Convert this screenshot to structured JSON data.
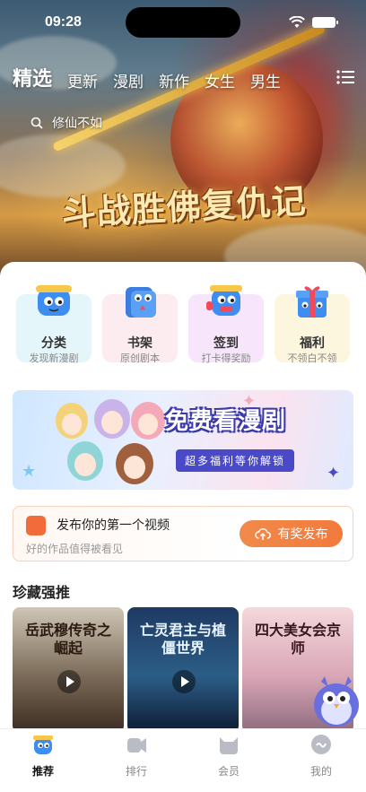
{
  "status_bar": {
    "time": "09:28"
  },
  "top_tabs": [
    {
      "label": "精选",
      "active": true
    },
    {
      "label": "更新",
      "active": false
    },
    {
      "label": "漫剧",
      "active": false
    },
    {
      "label": "新作",
      "active": false
    },
    {
      "label": "女生",
      "active": false
    },
    {
      "label": "男生",
      "active": false
    }
  ],
  "search": {
    "placeholder_text": "修仙不如"
  },
  "hero_banner": {
    "title": "斗战胜佛复仇记"
  },
  "categories": [
    {
      "title": "分类",
      "subtitle": "发现新漫剧",
      "bg": "#e5f6fb",
      "icon": "category-mascot-icon"
    },
    {
      "title": "书架",
      "subtitle": "原创剧本",
      "bg": "#fdecef",
      "icon": "bookshelf-mascot-icon"
    },
    {
      "title": "签到",
      "subtitle": "打卡得奖励",
      "bg": "#f7e6fb",
      "icon": "checkin-mascot-icon"
    },
    {
      "title": "福利",
      "subtitle": "不领白不领",
      "bg": "#fdf6df",
      "icon": "gift-mascot-icon"
    }
  ],
  "promo_banner": {
    "headline": "免费看漫剧",
    "subline": "超多福利等你解锁"
  },
  "upload_card": {
    "title": "发布你的第一个视频",
    "description": "好的作品值得被看见",
    "button_label": "有奖发布"
  },
  "section": {
    "title": "珍藏强推"
  },
  "posters": [
    {
      "title": "岳武穆传奇之崛起",
      "colors": [
        "#cfc6b6",
        "#7b6a58",
        "#3b2c22"
      ],
      "text_color": "#2a1a10"
    },
    {
      "title": "亡灵君主与植僵世界",
      "colors": [
        "#1f3a63",
        "#2b5d86",
        "#0e1b33"
      ],
      "text_color": "#e8f4ff"
    },
    {
      "title": "四大美女会京师",
      "colors": [
        "#f4d8dc",
        "#d9a6b6",
        "#8d6b7d"
      ],
      "text_color": "#3a1820"
    }
  ],
  "bottom_nav": [
    {
      "label": "推荐",
      "active": true,
      "icon": "recommend-icon"
    },
    {
      "label": "排行",
      "active": false,
      "icon": "ranking-icon"
    },
    {
      "label": "会员",
      "active": false,
      "icon": "membership-icon"
    },
    {
      "label": "我的",
      "active": false,
      "icon": "profile-icon"
    }
  ],
  "colors": {
    "accent": "#f27a3c",
    "promo_dark": "#4a49c7"
  }
}
